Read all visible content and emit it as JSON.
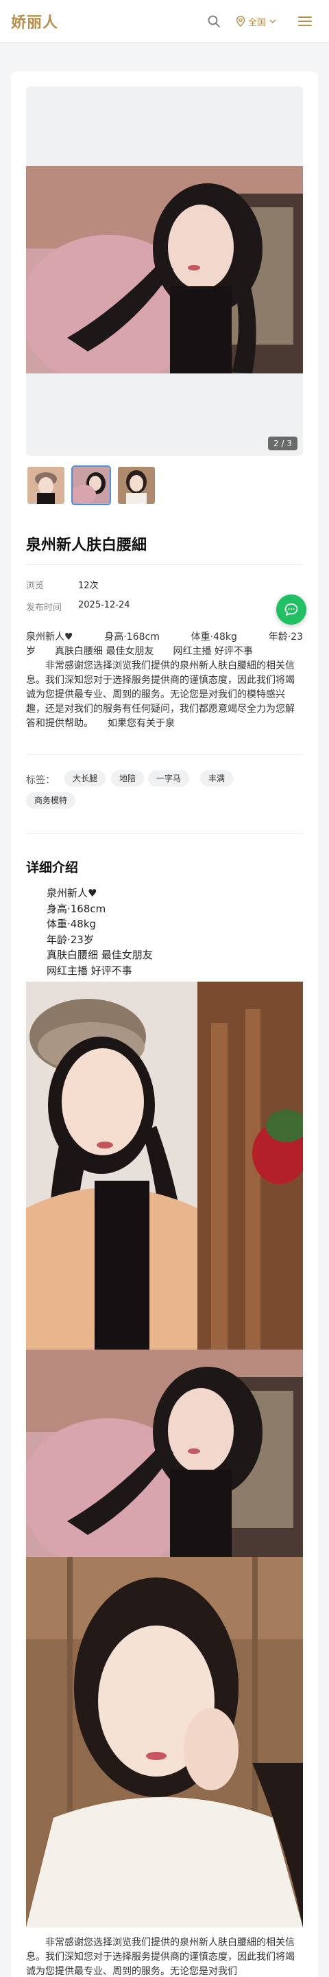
{
  "header": {
    "logo": "娇丽人",
    "region_label": "全国",
    "icons": [
      "search-icon",
      "location-pin-icon",
      "chevron-down-icon",
      "menu-icon"
    ],
    "accent_color": "#b88f4a"
  },
  "gallery": {
    "counter": "2 / 3",
    "current": 2,
    "total": 3
  },
  "listing": {
    "title": "泉州新人肤白腰細",
    "views_label": "浏览",
    "views_value": "12次",
    "date_label": "发布时间",
    "date_value": "2025-12-24"
  },
  "intro": {
    "cols": [
      "泉州新人♥",
      "身高·168cm",
      "体重·48kg",
      "年龄·23"
    ],
    "line2": "岁　　真肤白腰细 最佳女朋友　　网红主播 好评不事",
    "body": "　　非常感谢您选择浏览我们提供的泉州新人肤白腰細的相关信息。我们深知您对于选择服务提供商的谨慎态度，因此我们将竭诚为您提供最专业、周到的服务。无论您是对我们的模特感兴趣，还是对我们的服务有任何疑问，我们都愿意竭尽全力为您解答和提供帮助。　　如果您有关于泉"
  },
  "tags": {
    "label": "标签：",
    "items": [
      "大长腿",
      "地陪",
      "一字马",
      "丰满",
      "商务模特"
    ]
  },
  "details": {
    "title": "详细介绍",
    "lines": [
      "泉州新人♥",
      "身高·168cm",
      "体重·48kg",
      "年龄·23岁",
      "真肤白腰细 最佳女朋友",
      "网红主播 好评不事"
    ]
  },
  "bottom": {
    "text": "　　非常感谢您选择浏览我们提供的泉州新人肤白腰細的相关信息。我们深知您对于选择服务提供商的谨慎态度，因此我们将竭诚为您提供最专业、周到的服务。无论您是对我们"
  },
  "fab": {
    "icon": "chat-bubble-icon",
    "color": "#22c064"
  }
}
